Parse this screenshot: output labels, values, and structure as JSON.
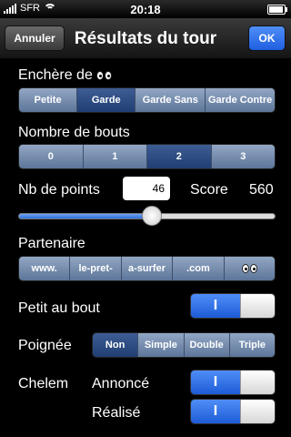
{
  "status_bar": {
    "carrier": "SFR",
    "time": "20:18"
  },
  "nav": {
    "cancel_label": "Annuler",
    "title": "Résultats du tour",
    "ok_label": "OK"
  },
  "enchere": {
    "label": "Enchère de",
    "options": [
      "Petite",
      "Garde",
      "Garde Sans",
      "Garde Contre"
    ],
    "selected_index": 1
  },
  "bouts": {
    "label": "Nombre de bouts",
    "options": [
      "0",
      "1",
      "2",
      "3"
    ],
    "selected_index": 2
  },
  "points": {
    "label": "Nb de points",
    "value": "46",
    "score_label": "Score",
    "score_value": "560"
  },
  "slider": {
    "value_fraction": 0.52
  },
  "partenaire": {
    "label": "Partenaire",
    "options": [
      "www.",
      "le-pret-",
      "a-surfer",
      ".com"
    ],
    "selected_index": -1
  },
  "petit_au_bout": {
    "label": "Petit au bout",
    "on_label": "I",
    "state": "on"
  },
  "poignee": {
    "label": "Poignée",
    "options": [
      "Non",
      "Simple",
      "Double",
      "Triple"
    ],
    "selected_index": 0
  },
  "chelem": {
    "label": "Chelem",
    "annonce_label": "Annoncé",
    "realise_label": "Réalisé",
    "on_label": "I",
    "annonce_state": "on",
    "realise_state": "on"
  },
  "colors": {
    "accent": "#2f6fd9",
    "segment": "#7089ad",
    "segment_selected": "#2a4a80"
  },
  "icons": {
    "eyes": "eyes-icon"
  }
}
